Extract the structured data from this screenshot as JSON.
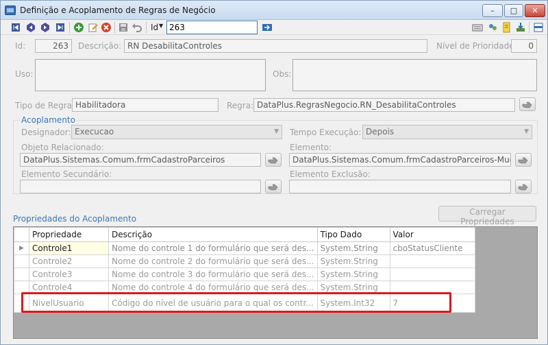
{
  "window": {
    "title": "Definição e Acoplamento de Regras de Negócio"
  },
  "toolbar": {
    "id_label": "Id",
    "id_value": "263"
  },
  "form": {
    "id_label": "Id:",
    "id_value": "263",
    "descricao_label": "Descrição:",
    "descricao_value": "RN DesabilitaControles",
    "prioridade_label": "Nível de Prioridade:",
    "prioridade_value": "0",
    "uso_label": "Uso:",
    "obs_label": "Obs:",
    "tipo_label": "Tipo de Regra:",
    "tipo_value": "Habilitadora",
    "regra_label": "Regra:",
    "regra_value": "DataPlus.RegrasNegocio.RN_DesabilitaControles"
  },
  "acoplamento": {
    "title": "Acoplamento",
    "designador_label": "Designador:",
    "designador_value": "Execucao",
    "tempo_label": "Tempo Execução:",
    "tempo_value": "Depois",
    "objeto_label": "Objeto Relacionado:",
    "objeto_value": "DataPlus.Sistemas.Comum.frmCadastroParceiros",
    "elemento_label": "Elemento:",
    "elemento_value": "DataPlus.Sistemas.Comum.frmCadastroParceiros-MudaEsta",
    "secundario_label": "Elemento Secundário:",
    "secundario_value": "",
    "exclusao_label": "Elemento Exclusão:",
    "exclusao_value": ""
  },
  "propriedades": {
    "title": "Propriedades do Acoplamento",
    "load_button": "Carregar Propriedades",
    "columns": [
      "Propriedade",
      "Descrição",
      "Tipo Dado",
      "Valor"
    ],
    "rows": [
      [
        "Controle1",
        "Nome do controle 1 do formulário que será des...",
        "System.String",
        "cboStatusCliente"
      ],
      [
        "Controle2",
        "Nome do controle 2 do formulário que será des...",
        "System.String",
        ""
      ],
      [
        "Controle3",
        "Nome do controle 3 do formulário que será des...",
        "System.String",
        ""
      ],
      [
        "Controle4",
        "Nome do controle 4 do formulário que será des...",
        "System.String",
        ""
      ],
      [
        "NivelUsuario",
        "Código do nível de usuário para o qual os contr...",
        "System.Int32",
        "7"
      ]
    ]
  }
}
